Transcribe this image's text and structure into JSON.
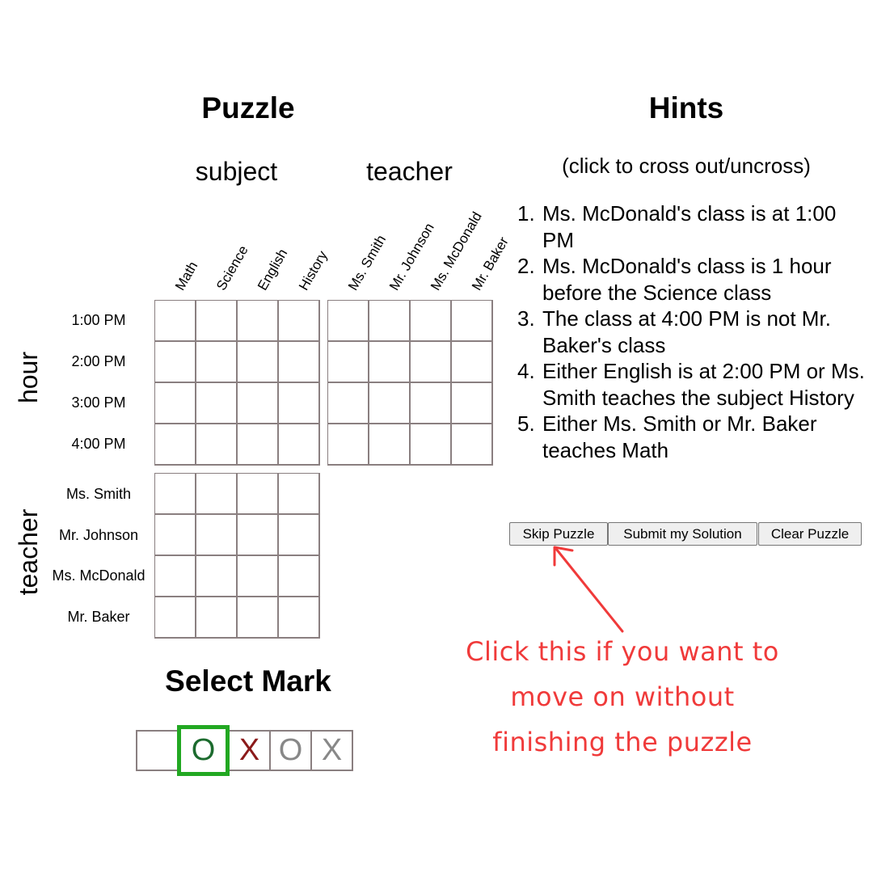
{
  "puzzle_title": "Puzzle",
  "hints_title": "Hints",
  "groups": {
    "subject": "subject",
    "teacher": "teacher"
  },
  "subjects": [
    "Math",
    "Science",
    "English",
    "History"
  ],
  "teachers": [
    "Ms. Smith",
    "Mr. Johnson",
    "Ms. McDonald",
    "Mr. Baker"
  ],
  "hours": [
    "1:00 PM",
    "2:00 PM",
    "3:00 PM",
    "4:00 PM"
  ],
  "axis_labels": {
    "hour": "hour",
    "teacher": "teacher"
  },
  "hint_note": "(click to cross out/uncross)",
  "hints": [
    {
      "num": "1.",
      "text": "Ms. McDonald's class is at 1:00 PM"
    },
    {
      "num": "2.",
      "text": "Ms. McDonald's class is 1 hour before the Science class"
    },
    {
      "num": "3.",
      "text": "The class at 4:00 PM is not Mr. Baker's class"
    },
    {
      "num": "4.",
      "text": "Either English is at 2:00 PM or Ms. Smith teaches the subject History"
    },
    {
      "num": "5.",
      "text": "Either Ms. Smith or Mr. Baker teaches Math"
    }
  ],
  "buttons": {
    "skip": "Skip Puzzle",
    "submit": "Submit my Solution",
    "clear": "Clear Puzzle"
  },
  "select_mark_title": "Select Mark",
  "marks": [
    "",
    "O",
    "X",
    "O",
    "X"
  ],
  "selected_mark_index": 1,
  "annotation": "Click this if you want to move on without finishing the puzzle",
  "colors": {
    "grid_border": "#8a7f80",
    "selected_mark_border": "#22a822",
    "annotation": "#f03a3a",
    "o_mark": "#1c6b2e",
    "x_mark": "#8b1a1a"
  }
}
